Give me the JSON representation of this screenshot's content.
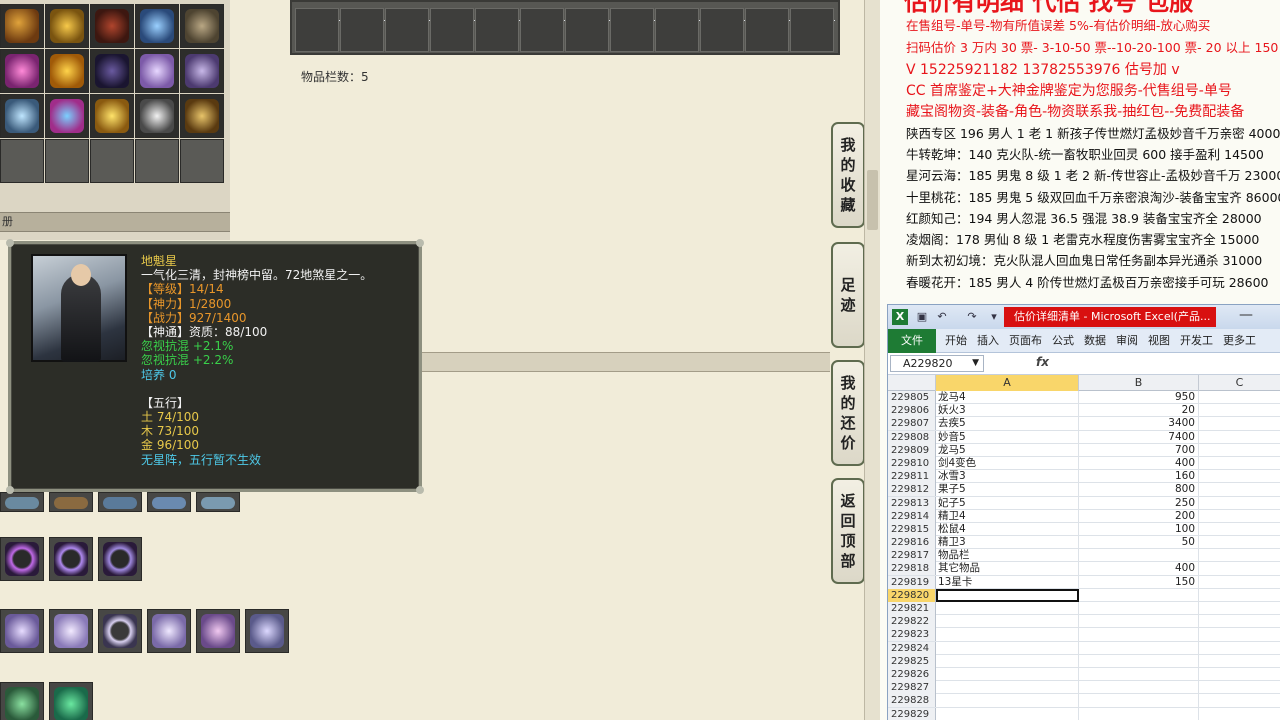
{
  "game": {
    "slots_count": "物品栏数：5",
    "left_strip_label": "册",
    "side_tabs": [
      "我的收藏",
      "足迹",
      "我的还价",
      "返回顶部"
    ]
  },
  "tooltip": {
    "name": "地魁星",
    "desc": "一气化三清，封神榜中留。72地煞星之一。",
    "level": "【等级】14/14",
    "power": "【神力】1/2800",
    "combat": "【战力】927/1400",
    "divine": "【神通】资质：88/100",
    "stat1": "忽视抗混 +2.1%",
    "stat2": "忽视抗混 +2.2%",
    "train": "培养 0",
    "elements_title": "【五行】",
    "earth": "土 74/100",
    "wood": "木 73/100",
    "metal": "金 96/100",
    "note": "无星阵，五行暂不生效"
  },
  "doc": {
    "title": "估价有明细 代估 找号 包服",
    "lines": [
      {
        "text": "在售组号-单号-物有所值误差 5%-有估价明细-放心购买",
        "color": "red"
      },
      {
        "text": "扫码估价 3 万内 30 票- 3-10-50 票--10-20-100 票- 20 以上 150",
        "color": "red"
      },
      {
        "text": "V 15225921182   13782553976   估号加 v",
        "color": "red"
      },
      {
        "text": "CC 首席鉴定+大神金牌鉴定为您服务-代售组号-单号",
        "color": "red"
      },
      {
        "text": "藏宝阁物资-装备-角色-物资联系我-抽红包--免费配装备",
        "color": "red"
      },
      {
        "text": "陕西专区 196 男人 1 老 1 新孩子传世燃灯孟极妙音千万亲密 40000",
        "color": "black"
      },
      {
        "text": "牛转乾坤：140 克火队-统一畜牧职业回灵 600 接手盈利 14500",
        "color": "black"
      },
      {
        "text": "星河云海：185 男鬼 8 级 1 老 2 新-传世容止-孟极妙音千万 23000",
        "color": "black"
      },
      {
        "text": "十里桃花：185 男鬼 5 级双回血千万亲密浪淘沙-装备宝宝齐 86000",
        "color": "black"
      },
      {
        "text": "红颜知己：194 男人忽混 36.5 强混 38.9 装备宝宝齐全 28000",
        "color": "black"
      },
      {
        "text": "凌烟阁：178 男仙 8 级 1 老雷克水程度伤害雾宝宝齐全 15000",
        "color": "black"
      },
      {
        "text": "新到太初幻境：克火队混人回血鬼日常任务副本异光通杀 31000",
        "color": "black"
      },
      {
        "text": "春暖花开：185 男人 4 阶传世燃灯孟极百万亲密接手可玩 28600",
        "color": "black"
      }
    ]
  },
  "excel": {
    "title": "估价详细清单 - Microsoft Excel(产品...",
    "tabs": [
      "文件",
      "开始",
      "插入",
      "页面布",
      "公式",
      "数据",
      "审阅",
      "视图",
      "开发工",
      "更多工"
    ],
    "name_box": "A229820",
    "fx": "fx",
    "columns": [
      "A",
      "B",
      "C"
    ],
    "rows": [
      {
        "n": "229805",
        "a": "龙马4",
        "b": "950"
      },
      {
        "n": "229806",
        "a": "妖火3",
        "b": "20"
      },
      {
        "n": "229807",
        "a": "去疾5",
        "b": "3400"
      },
      {
        "n": "229808",
        "a": "妙音5",
        "b": "7400"
      },
      {
        "n": "229809",
        "a": "龙马5",
        "b": "700"
      },
      {
        "n": "229810",
        "a": "剑4变色",
        "b": "400"
      },
      {
        "n": "229811",
        "a": "冰雪3",
        "b": "160"
      },
      {
        "n": "229812",
        "a": "果子5",
        "b": "800"
      },
      {
        "n": "229813",
        "a": "妃子5",
        "b": "250"
      },
      {
        "n": "229814",
        "a": "精卫4",
        "b": "200"
      },
      {
        "n": "229815",
        "a": "松鼠4",
        "b": "100"
      },
      {
        "n": "229816",
        "a": "精卫3",
        "b": "50"
      },
      {
        "n": "229817",
        "a": "物品栏",
        "b": ""
      },
      {
        "n": "229818",
        "a": "其它物品",
        "b": "400"
      },
      {
        "n": "229819",
        "a": "13星卡",
        "b": "150"
      },
      {
        "n": "229820",
        "a": "",
        "b": ""
      },
      {
        "n": "229821",
        "a": "",
        "b": ""
      },
      {
        "n": "229822",
        "a": "",
        "b": ""
      },
      {
        "n": "229823",
        "a": "",
        "b": ""
      },
      {
        "n": "229824",
        "a": "",
        "b": ""
      },
      {
        "n": "229825",
        "a": "",
        "b": ""
      },
      {
        "n": "229826",
        "a": "",
        "b": ""
      },
      {
        "n": "229827",
        "a": "",
        "b": ""
      },
      {
        "n": "229828",
        "a": "",
        "b": ""
      },
      {
        "n": "229829",
        "a": "",
        "b": ""
      }
    ]
  },
  "colors": {
    "accent_red": "#e8151b",
    "excel_green": "#1e7b34",
    "tooltip_gold": "#e7c84a",
    "tooltip_green": "#39d04a",
    "tooltip_cyan": "#4ec9e8",
    "tooltip_orange": "#e8962a"
  }
}
